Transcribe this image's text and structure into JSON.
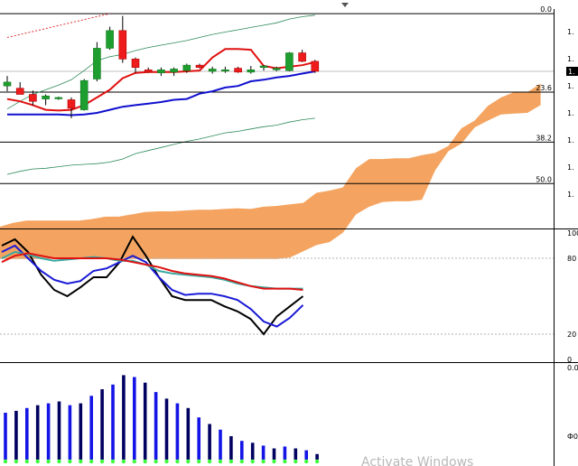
{
  "chart_data": [
    {
      "type": "candlestick",
      "panel": "price",
      "candles": [
        {
          "o": 0.25,
          "h": 0.38,
          "l": 0.18,
          "c": 0.3
        },
        {
          "o": 0.22,
          "h": 0.3,
          "l": 0.14,
          "c": 0.14
        },
        {
          "o": 0.14,
          "h": 0.19,
          "l": 0.0,
          "c": 0.05
        },
        {
          "o": 0.08,
          "h": 0.14,
          "l": 0.0,
          "c": 0.12
        },
        {
          "o": 0.09,
          "h": 0.11,
          "l": 0.07,
          "c": 0.1
        },
        {
          "o": 0.07,
          "h": 0.1,
          "l": -0.17,
          "c": -0.04
        },
        {
          "o": -0.06,
          "h": 0.34,
          "l": -0.07,
          "c": 0.32
        },
        {
          "o": 0.34,
          "h": 0.82,
          "l": 0.31,
          "c": 0.74
        },
        {
          "o": 0.74,
          "h": 1.02,
          "l": 0.72,
          "c": 0.97
        },
        {
          "o": 0.97,
          "h": 1.16,
          "l": 0.55,
          "c": 0.6
        },
        {
          "o": 0.6,
          "h": 0.62,
          "l": 0.42,
          "c": 0.49
        },
        {
          "o": 0.46,
          "h": 0.49,
          "l": 0.42,
          "c": 0.43
        },
        {
          "o": 0.42,
          "h": 0.49,
          "l": 0.38,
          "c": 0.46
        },
        {
          "o": 0.43,
          "h": 0.49,
          "l": 0.38,
          "c": 0.47
        },
        {
          "o": 0.45,
          "h": 0.54,
          "l": 0.42,
          "c": 0.52
        },
        {
          "o": 0.52,
          "h": 0.54,
          "l": 0.48,
          "c": 0.49
        },
        {
          "o": 0.44,
          "h": 0.5,
          "l": 0.41,
          "c": 0.47
        },
        {
          "o": 0.46,
          "h": 0.5,
          "l": 0.42,
          "c": 0.46
        },
        {
          "o": 0.48,
          "h": 0.5,
          "l": 0.42,
          "c": 0.43
        },
        {
          "o": 0.43,
          "h": 0.51,
          "l": 0.41,
          "c": 0.46
        },
        {
          "o": 0.49,
          "h": 0.52,
          "l": 0.45,
          "c": 0.51
        },
        {
          "o": 0.46,
          "h": 0.5,
          "l": 0.44,
          "c": 0.48
        },
        {
          "o": 0.45,
          "h": 0.69,
          "l": 0.44,
          "c": 0.68
        },
        {
          "o": 0.68,
          "h": 0.72,
          "l": 0.56,
          "c": 0.57
        },
        {
          "o": 0.57,
          "h": 0.59,
          "l": 0.42,
          "c": 0.44
        }
      ],
      "ma_fast_red": [
        0.08,
        0.05,
        0.0,
        -0.06,
        -0.07,
        -0.06,
        0.0,
        0.1,
        0.2,
        0.35,
        0.42,
        0.43,
        0.43,
        0.43,
        0.44,
        0.45,
        0.62,
        0.73,
        0.73,
        0.72,
        0.51,
        0.48,
        0.5,
        0.52,
        0.56
      ],
      "ma_slow_blue": [
        -0.12,
        -0.12,
        -0.12,
        -0.12,
        -0.12,
        -0.13,
        -0.12,
        -0.1,
        -0.06,
        -0.02,
        0.0,
        0.02,
        0.04,
        0.07,
        0.08,
        0.15,
        0.18,
        0.23,
        0.25,
        0.31,
        0.33,
        0.36,
        0.38,
        0.41,
        0.44
      ],
      "band_upper_green": [
        -0.05,
        0.05,
        0.14,
        0.2,
        0.26,
        0.33,
        0.45,
        0.58,
        0.63,
        0.66,
        0.71,
        0.75,
        0.78,
        0.81,
        0.84,
        0.88,
        0.92,
        0.95,
        0.98,
        1.01,
        1.04,
        1.07,
        1.12,
        1.15,
        1.17
      ],
      "line_lower_green": [
        -0.9,
        -0.86,
        -0.83,
        -0.82,
        -0.8,
        -0.78,
        -0.77,
        -0.76,
        -0.74,
        -0.7,
        -0.63,
        -0.59,
        -0.55,
        -0.51,
        -0.47,
        -0.44,
        -0.4,
        -0.36,
        -0.34,
        -0.31,
        -0.28,
        -0.26,
        -0.22,
        -0.19,
        -0.17
      ],
      "cloud_top": [
        -1.58,
        -1.53,
        -1.5,
        -1.5,
        -1.5,
        -1.5,
        -1.5,
        -1.48,
        -1.45,
        -1.45,
        -1.42,
        -1.39,
        -1.38,
        -1.38,
        -1.37,
        -1.36,
        -1.36,
        -1.35,
        -1.34,
        -1.35,
        -1.32,
        -1.31,
        -1.29,
        -1.27,
        -1.14,
        -1.11,
        -1.07,
        -0.82,
        -0.7,
        -0.7,
        -0.69,
        -0.69,
        -0.65,
        -0.62,
        -0.53,
        -0.3,
        -0.2,
        -0.01,
        0.1,
        0.17,
        0.17,
        0.28
      ],
      "cloud_bottom": [
        -2.0,
        -2.0,
        -2.0,
        -2.0,
        -2.0,
        -2.0,
        -2.0,
        -2.0,
        -2.0,
        -2.0,
        -2.0,
        -2.0,
        -2.0,
        -2.0,
        -2.0,
        -2.0,
        -2.0,
        -2.0,
        -2.0,
        -2.0,
        -2.0,
        -2.0,
        -1.98,
        -1.9,
        -1.82,
        -1.78,
        -1.66,
        -1.42,
        -1.32,
        -1.26,
        -1.25,
        -1.25,
        -1.23,
        -0.85,
        -0.6,
        -0.5,
        -0.29,
        -0.2,
        -0.12,
        -0.11,
        -0.1,
        0.0
      ],
      "trendline_dotted": [
        {
          "i": 0,
          "v": 0.88
        },
        {
          "i": 8,
          "v": 1.19
        }
      ],
      "fib_levels": [
        {
          "label": "0.0",
          "v": 1.19
        },
        {
          "label": "23.6",
          "v": 0.17
        },
        {
          "label": "38.2",
          "v": -0.48
        },
        {
          "label": "50.0",
          "v": -1.02
        }
      ],
      "current_price_line": 0.44,
      "ylim": [
        -1.58,
        1.25
      ],
      "y_ticks": [
        "1.",
        "1.",
        "1.",
        "1.",
        "1.",
        "1.",
        "1."
      ],
      "current_price_label": "1."
    },
    {
      "type": "line",
      "panel": "stochastic",
      "ylim": [
        0,
        100
      ],
      "y_ticks": [
        "100",
        "80",
        "20",
        "0"
      ],
      "levels": [
        80,
        20
      ],
      "series": [
        {
          "color": "#000000",
          "values": [
            90,
            95,
            85,
            67,
            55,
            50,
            57,
            65,
            65,
            77,
            97,
            82,
            65,
            50,
            47,
            47,
            47,
            42,
            38,
            32,
            20,
            34,
            42,
            50
          ]
        },
        {
          "color": "#1a1ad6",
          "values": [
            85,
            90,
            80,
            70,
            63,
            60,
            62,
            70,
            72,
            77,
            82,
            77,
            65,
            55,
            51,
            52,
            52,
            50,
            47,
            40,
            30,
            26,
            33,
            43
          ]
        },
        {
          "color": "#3aa8a0",
          "values": [
            80,
            85,
            83,
            80,
            78,
            79,
            80,
            81,
            80,
            78,
            78,
            75,
            70,
            68,
            67,
            66,
            65,
            63,
            60,
            58,
            57,
            56,
            56,
            56
          ]
        },
        {
          "color": "#e01010",
          "values": [
            77,
            82,
            84,
            82,
            80,
            80,
            80,
            80,
            80,
            79,
            77,
            75,
            73,
            70,
            68,
            67,
            66,
            64,
            61,
            58,
            56,
            56,
            56,
            55
          ]
        }
      ]
    },
    {
      "type": "bar",
      "panel": "histogram",
      "ylim": [
        0,
        100
      ],
      "y_ticks": [
        "0.0",
        "Ф0"
      ],
      "values": [
        50,
        52,
        55,
        58,
        60,
        62,
        58,
        60,
        68,
        75,
        80,
        90,
        88,
        82,
        72,
        65,
        60,
        55,
        45,
        38,
        32,
        25,
        20,
        18,
        15,
        12,
        14,
        12,
        10,
        6
      ]
    }
  ],
  "watermark": "Activate Windows"
}
